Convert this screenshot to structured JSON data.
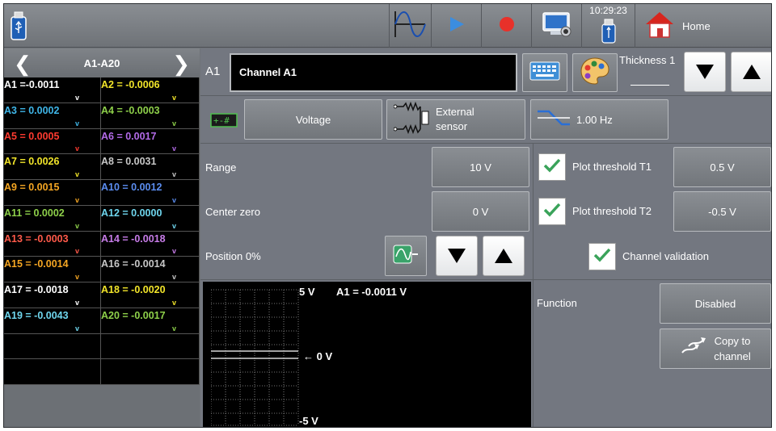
{
  "colors": {
    "frame_bg": "#6f7378",
    "grid_bg": "#000000",
    "record_red": "#e8312a",
    "play_blue": "#3b8de0",
    "check_green": "#3aa35a"
  },
  "topbar": {
    "usb_icon": "usb-drive-icon",
    "waveform_icon": "sine-wave-icon",
    "play_icon": "play-icon",
    "record_icon": "record-icon",
    "screenshot_icon": "screenshot-icon",
    "clock": "10:29:23",
    "home_label": "Home"
  },
  "channels": {
    "page_label": "A1-A20",
    "items": [
      {
        "text": "A1 =-0.0011",
        "color": "#ffffff"
      },
      {
        "text": "A2 = -0.0006",
        "color": "#f2e52a"
      },
      {
        "text": "A3 = 0.0002",
        "color": "#3fb6e8"
      },
      {
        "text": "A4 = -0.0003",
        "color": "#8ed04a"
      },
      {
        "text": "A5 = 0.0005",
        "color": "#ff3b30"
      },
      {
        "text": "A6 = 0.0017",
        "color": "#b36be8"
      },
      {
        "text": "A7 = 0.0026",
        "color": "#f2e52a"
      },
      {
        "text": "A8 = 0.0031",
        "color": "#c7c7c7"
      },
      {
        "text": "A9 = 0.0015",
        "color": "#f5a623"
      },
      {
        "text": "A10 = 0.0012",
        "color": "#5b8def"
      },
      {
        "text": "A11 = 0.0002",
        "color": "#8ed04a"
      },
      {
        "text": "A12 = 0.0000",
        "color": "#6fd6ee"
      },
      {
        "text": "A13 = -0.0003",
        "color": "#ff5a4a"
      },
      {
        "text": "A14 = -0.0018",
        "color": "#c77ce8"
      },
      {
        "text": "A15 = -0.0014",
        "color": "#f5a623"
      },
      {
        "text": "A16 = -0.0014",
        "color": "#c7c7c7"
      },
      {
        "text": "A17 = -0.0018",
        "color": "#ffffff"
      },
      {
        "text": "A18 = -0.0020",
        "color": "#f2e52a"
      },
      {
        "text": "A19 = -0.0043",
        "color": "#6fd6ee"
      },
      {
        "text": "A20 = -0.0017",
        "color": "#8ed04a"
      }
    ],
    "arrow_glyph": "v"
  },
  "channel": {
    "short_label": "A1",
    "name_value": "Channel A1",
    "thickness_label": "Thickness 1"
  },
  "input": {
    "type_label": "Voltage",
    "sensor_label_1": "External",
    "sensor_label_2": "sensor",
    "filter_label": "1.00 Hz"
  },
  "settings": {
    "range_label": "Range",
    "range_value": "10 V",
    "center_zero_label": "Center zero",
    "center_zero_value": "0 V",
    "position_label": "Position 0%",
    "threshold1_label": "Plot threshold T1",
    "threshold1_value": "0.5 V",
    "threshold2_label": "Plot threshold T2",
    "threshold2_value": "-0.5 V",
    "validation_label": "Channel validation"
  },
  "preview": {
    "top_label": "5 V",
    "mid_label": "← 0 V",
    "bottom_label": "-5 V",
    "readout": "A1 = -0.0011 V"
  },
  "function": {
    "label": "Function",
    "value": "Disabled",
    "copy_label_1": "Copy to",
    "copy_label_2": "channel"
  }
}
